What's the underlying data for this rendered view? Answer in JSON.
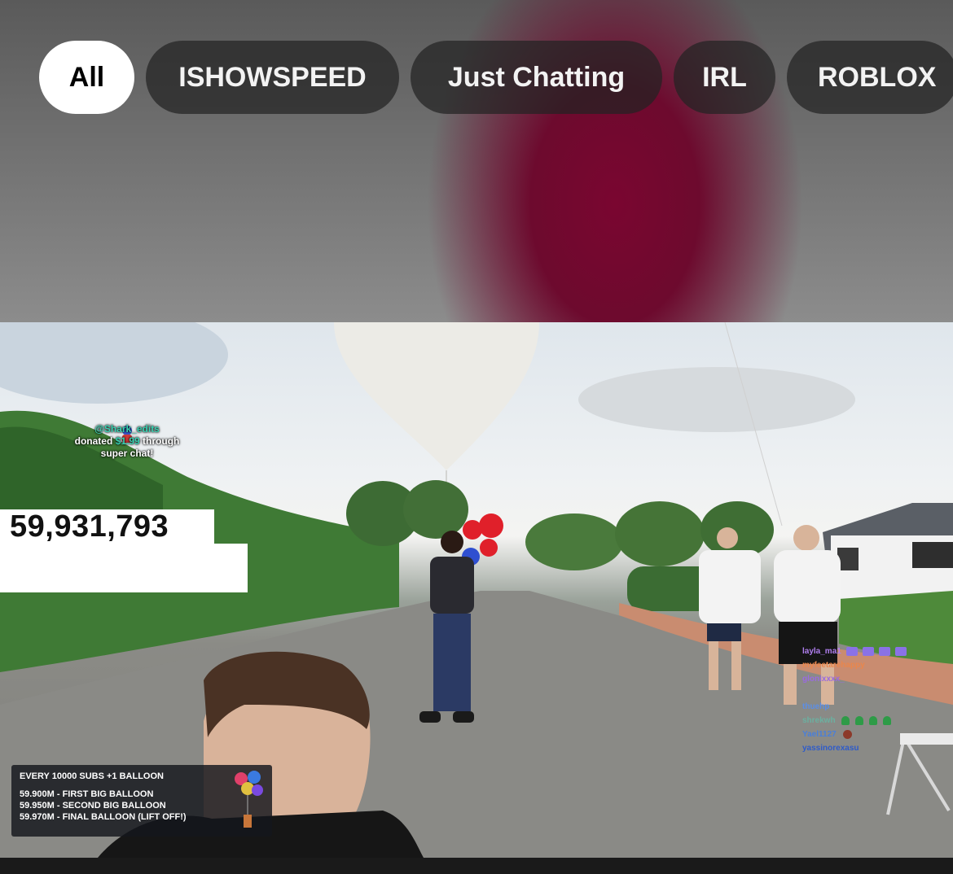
{
  "chips": [
    {
      "label": "All",
      "active": true
    },
    {
      "label": "ISHOWSPEED",
      "active": false
    },
    {
      "label": "Just Chatting",
      "active": false
    },
    {
      "label": "IRL",
      "active": false
    },
    {
      "label": "ROBLOX",
      "active": false
    }
  ],
  "stream": {
    "subscriber_count": "59,931,793",
    "donation": {
      "name": "@Shark_edits",
      "text_before": "donated",
      "amount": "$1.99",
      "text_after": "through",
      "line2": "super chat!"
    },
    "chat": [
      {
        "user": "layla_ma1",
        "color": "#b07ff0",
        "badges": "purple"
      },
      {
        "user": "myfeetarehappy",
        "color": "#e9864c",
        "badges": ""
      },
      {
        "user": "glonixxxx_",
        "color": "#9a6ae0",
        "badges": ""
      },
      {
        "user": "",
        "color": "",
        "badges": ""
      },
      {
        "user": "thuehp",
        "color": "#5b8ee6",
        "badges": ""
      },
      {
        "user": "shrekwh",
        "color": "#6bb0a0",
        "badges": "green"
      },
      {
        "user": "Yael1127",
        "color": "#4a7fd8",
        "badges": "brown"
      },
      {
        "user": "yassinorexasu",
        "color": "#2e5bc9",
        "badges": ""
      }
    ],
    "goals": {
      "title": "EVERY 10000 SUBS +1 BALLOON",
      "items": [
        "59.900M - FIRST BIG BALLOON",
        "59.950M - SECOND BIG BALLOON",
        "59.970M - FINAL BALLOON (LIFT OFF!)"
      ]
    }
  },
  "colors": {
    "active_chip_bg": "#ffffff",
    "chip_bg": "#2f2f2f",
    "header_accent": "#6d0a2e"
  }
}
